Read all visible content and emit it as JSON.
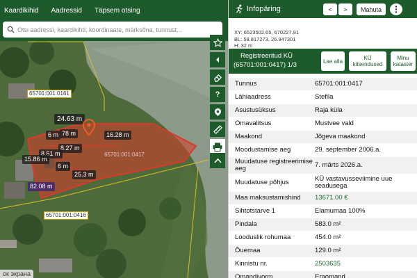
{
  "map": {
    "tabs": [
      "Kaardikihid",
      "Aadressid",
      "Täpsem otsing"
    ],
    "search_placeholder": "Otsi aadressi, kaardikihti, koordinaate, märksõna, tunnust...",
    "tool_icons": [
      "star-icon",
      "collapse-icon",
      "eraser-icon",
      "help-icon",
      "location-pin-icon",
      "ruler-icon",
      "printer-icon",
      "chevron-up-icon"
    ],
    "measurements": {
      "m1": "24.63 m",
      "m2": "6 m",
      "m3": "78 m",
      "m4": "16.28 m",
      "m5": "8.27 m",
      "m6": "8.51 m",
      "m7": "15.86 m",
      "m8": "6 m",
      "m9": "25.3 m",
      "m10": "82.08 m"
    },
    "plot_labels": {
      "p1": "65701:001:0161",
      "p2": "65701:001:0416"
    },
    "parcel_label": "65701:001:0417",
    "language_hint": "ок экрана"
  },
  "panel": {
    "title": "Infopäring",
    "title_icon": "run-icon",
    "prev": "<",
    "next": ">",
    "close_label": "Mahuta",
    "more_icon": "more-vertical-icon",
    "coords": {
      "xy": "XY: 6523502.65, 670227.91",
      "bl": "BL: 58.817273, 26.947301",
      "h": "H: 32 m"
    },
    "register_title_1": "Registreeritud KÜ",
    "register_title_2": "(65701:001:0417) 1/3",
    "buttons": {
      "b1": "Lae alla",
      "b2": "KÜ kitsendused",
      "b3": "Minu kataster"
    },
    "rows": [
      {
        "k": "Tunnus",
        "v": "65701:001:0417",
        "g": false
      },
      {
        "k": "Lähiaadress",
        "v": "Stefila",
        "g": false
      },
      {
        "k": "Asustusüksus",
        "v": "Raja küla",
        "g": false
      },
      {
        "k": "Omavalitsus",
        "v": "Mustvee vald",
        "g": false
      },
      {
        "k": "Maakond",
        "v": "Jõgeva maakond",
        "g": false
      },
      {
        "k": "Moodustamise aeg",
        "v": "29. september 2006.a.",
        "g": false
      },
      {
        "k": "Muudatuse registreerimise aeg",
        "v": "7. märts 2026.a.",
        "g": false
      },
      {
        "k": "Muudatuse põhjus",
        "v": "KÜ vastavusseviimine uue seadusega",
        "g": false
      },
      {
        "k": "Maa maksustamishind",
        "v": "13671.00 €",
        "g": true
      },
      {
        "k": "Sihtotstarve 1",
        "v": "Elamumaa 100%",
        "g": false
      },
      {
        "k": "Pindala",
        "v": "583.0 m²",
        "g": false
      },
      {
        "k": "Looduslik rohumaa",
        "v": "454.0 m²",
        "g": false
      },
      {
        "k": "Õuemaa",
        "v": "129.0 m²",
        "g": false
      },
      {
        "k": "Kinnistu nr.",
        "v": "2503635",
        "g": true
      },
      {
        "k": "Omandivorm",
        "v": "Eraomand",
        "g": false
      }
    ],
    "colors": {
      "brand_green": "#1e5b2c",
      "parcel_red": "#d93a2a"
    }
  }
}
